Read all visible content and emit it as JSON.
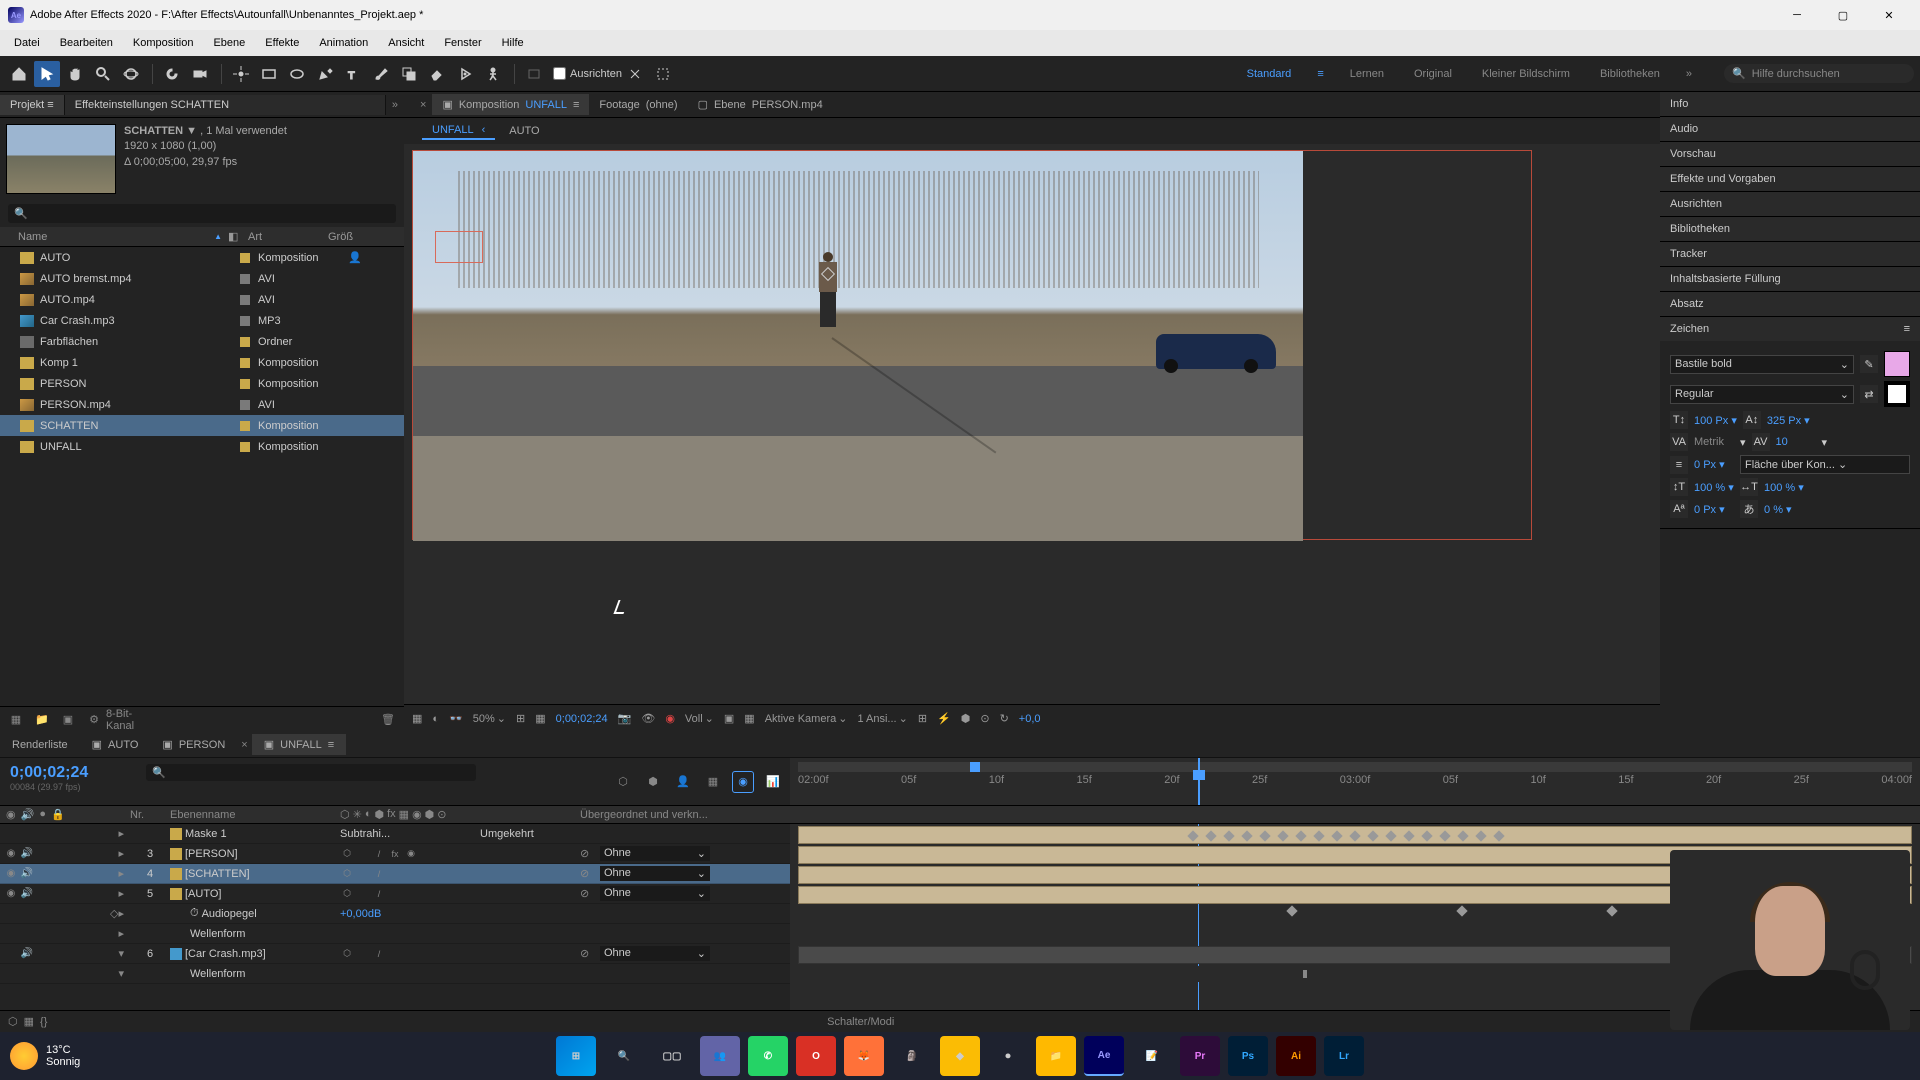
{
  "titlebar": {
    "title": "Adobe After Effects 2020 - F:\\After Effects\\Autounfall\\Unbenanntes_Projekt.aep *"
  },
  "menu": [
    "Datei",
    "Bearbeiten",
    "Komposition",
    "Ebene",
    "Effekte",
    "Animation",
    "Ansicht",
    "Fenster",
    "Hilfe"
  ],
  "toolbar": {
    "align": "Ausrichten",
    "workspaces": [
      "Standard",
      "Lernen",
      "Original",
      "Kleiner Bildschirm",
      "Bibliotheken"
    ],
    "workspace_active": "Standard",
    "search_placeholder": "Hilfe durchsuchen"
  },
  "project": {
    "tab_label": "Projekt",
    "settings_label": "Effekteinstellungen SCHATTEN",
    "selected_name": "SCHATTEN",
    "selected_used": ", 1 Mal verwendet",
    "selected_res": "1920 x 1080 (1,00)",
    "selected_dur": "Δ 0;00;05;00, 29,97 fps",
    "cols": {
      "name": "Name",
      "type": "Art",
      "size": "Größ"
    },
    "footer_depth": "8-Bit-Kanal",
    "items": [
      {
        "name": "AUTO",
        "type": "Komposition",
        "icon": "comp",
        "swatch": "yellow",
        "shy": true
      },
      {
        "name": "AUTO bremst.mp4",
        "type": "AVI",
        "icon": "avi",
        "swatch": "gray"
      },
      {
        "name": "AUTO.mp4",
        "type": "AVI",
        "icon": "avi",
        "swatch": "gray"
      },
      {
        "name": "Car Crash.mp3",
        "type": "MP3",
        "icon": "mp3",
        "swatch": "gray"
      },
      {
        "name": "Farbflächen",
        "type": "Ordner",
        "icon": "folder",
        "swatch": "yellow"
      },
      {
        "name": "Komp 1",
        "type": "Komposition",
        "icon": "comp",
        "swatch": "yellow"
      },
      {
        "name": "PERSON",
        "type": "Komposition",
        "icon": "comp",
        "swatch": "yellow"
      },
      {
        "name": "PERSON.mp4",
        "type": "AVI",
        "icon": "avi",
        "swatch": "gray"
      },
      {
        "name": "SCHATTEN",
        "type": "Komposition",
        "icon": "comp",
        "swatch": "yellow",
        "selected": true
      },
      {
        "name": "UNFALL",
        "type": "Komposition",
        "icon": "comp",
        "swatch": "yellow"
      }
    ]
  },
  "comp_tabs": [
    {
      "label": "Komposition",
      "name": "UNFALL",
      "active": true
    },
    {
      "label": "Footage",
      "name": "(ohne)"
    },
    {
      "label": "Ebene",
      "name": "PERSON.mp4"
    }
  ],
  "flow_tabs": [
    {
      "label": "UNFALL",
      "active": true,
      "chev": true
    },
    {
      "label": "AUTO"
    }
  ],
  "viewer_footer": {
    "zoom": "50%",
    "timecode": "0;00;02;24",
    "res": "Voll",
    "camera": "Aktive Kamera",
    "views": "1 Ansi...",
    "exposure": "+0,0"
  },
  "right_panels": [
    "Info",
    "Audio",
    "Vorschau",
    "Effekte und Vorgaben",
    "Ausrichten",
    "Bibliotheken",
    "Tracker",
    "Inhaltsbasierte Füllung",
    "Absatz"
  ],
  "char": {
    "title": "Zeichen",
    "font": "Bastile bold",
    "style": "Regular",
    "size": "100",
    "size_u": "Px",
    "leading": "325",
    "leading_u": "Px",
    "kerning": "Metrik",
    "tracking": "10",
    "stroke": "0",
    "stroke_u": "Px",
    "fill_label": "Fläche über Kon...",
    "vscale": "100",
    "vscale_u": "%",
    "hscale": "100",
    "hscale_u": "%",
    "baseline": "0",
    "baseline_u": "Px",
    "tsume": "0",
    "tsume_u": "%"
  },
  "bottom": {
    "tabs": [
      "Renderliste",
      "AUTO",
      "PERSON",
      "UNFALL"
    ],
    "active_tab": "UNFALL",
    "timecode": "0;00;02;24",
    "subframe": "00084 (29.97 fps)",
    "cols": {
      "nr": "Nr.",
      "name": "Ebenenname",
      "parent": "Übergeordnet und verkn..."
    },
    "ruler": [
      "02:00f",
      "05f",
      "10f",
      "15f",
      "20f",
      "25f",
      "03:00f",
      "05f",
      "10f",
      "15f",
      "20f",
      "25f",
      "04:00f"
    ],
    "footer": "Schalter/Modi",
    "mask_row": {
      "name": "Maske 1",
      "mode": "Subtrahi...",
      "inv": "Umgekehrt"
    },
    "layers": [
      {
        "num": "3",
        "name": "[PERSON]",
        "parent": "Ohne",
        "color": "#c9a94a"
      },
      {
        "num": "4",
        "name": "[SCHATTEN]",
        "parent": "Ohne",
        "color": "#c9a94a",
        "selected": true
      },
      {
        "num": "5",
        "name": "[AUTO]",
        "parent": "Ohne",
        "color": "#c9a94a"
      }
    ],
    "audio": {
      "label": "Audiopegel",
      "value": "+0,00dB",
      "wave": "Wellenform"
    },
    "layer6": {
      "num": "6",
      "name": "[Car Crash.mp3]",
      "parent": "Ohne",
      "wave": "Wellenform"
    }
  },
  "taskbar": {
    "temp": "13°C",
    "cond": "Sonnig"
  }
}
